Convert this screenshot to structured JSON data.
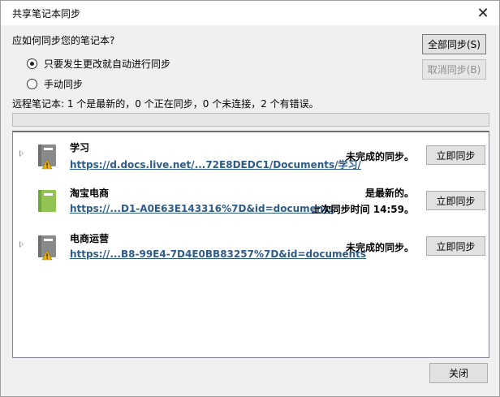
{
  "dialog": {
    "title": "共享笔记本同步",
    "question": "应如何同步您的笔记本?",
    "sync_all_label": "全部同步(S)",
    "cancel_sync_label": "取消同步(B)",
    "options": {
      "auto_label": "只要发生更改就自动进行同步",
      "manual_label": "手动同步",
      "selected": "auto"
    },
    "summary": "远程笔记本: 1 个是最新的，0 个正在同步，0 个未连接，2 个有错误。",
    "close_label": "关闭"
  },
  "notebooks": [
    {
      "name": "学习",
      "link": "https://d.docs.live.net/...72E8DEDC1/Documents/学习/",
      "status": "未完成的同步。",
      "status_detail": "",
      "sync_label": "立即同步",
      "icon_color": "#8a8a8a",
      "warning": true
    },
    {
      "name": "淘宝电商",
      "link": "https://...D1-A0E63E143316%7D&id=documents",
      "status": "是最新的。",
      "status_detail": "上次同步时间 14:59。",
      "sync_label": "立即同步",
      "icon_color": "#92c353",
      "warning": false
    },
    {
      "name": "电商运营",
      "link": "https://...B8-99E4-7D4E0BB83257%7D&id=documents",
      "status": "未完成的同步。",
      "status_detail": "",
      "sync_label": "立即同步",
      "icon_color": "#8a8a8a",
      "warning": true
    }
  ]
}
